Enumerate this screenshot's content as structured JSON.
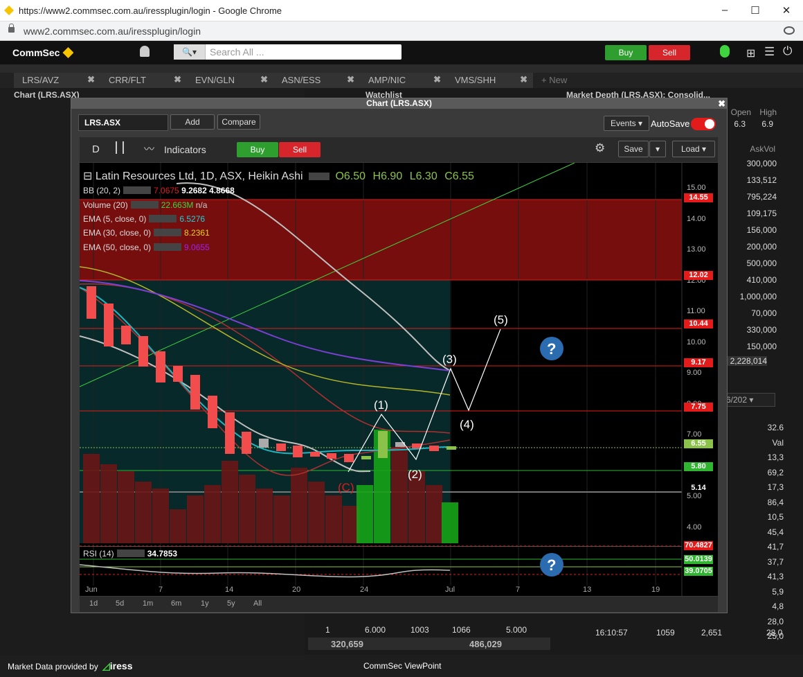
{
  "browser": {
    "title": "https://www2.commsec.com.au/iressplugin/login - Google Chrome",
    "url": "www2.commsec.com.au/iressplugin/login"
  },
  "app": {
    "logo": "CommSec",
    "search_placeholder": "Search All ...",
    "buy": "Buy",
    "sell": "Sell"
  },
  "tabs": [
    "LRS/AVZ",
    "CRR/FLT",
    "EVN/GLN",
    "ASN/ESS",
    "AMP/NIC",
    "VMS/SHH"
  ],
  "new_tab": "+ New",
  "panels": {
    "left": "Chart (LRS.ASX)",
    "watchlist": "Watchlist",
    "depth": "Market Depth (LRS.ASX): Consolid..."
  },
  "modal": {
    "title": "Chart (LRS.ASX)",
    "symbol": "LRS.ASX",
    "add": "Add",
    "compare": "Compare",
    "events": "Events",
    "autosave": "AutoSave",
    "interval": "D",
    "indicators": "Indicators",
    "buy": "Buy",
    "sell": "Sell",
    "save": "Save",
    "load": "Load"
  },
  "legend": {
    "name": "Latin Resources Ltd, 1D, ASX, Heikin Ashi",
    "o": "O6.50",
    "h": "H6.90",
    "l": "L6.30",
    "c": "C6.55"
  },
  "indicators": [
    {
      "label": "BB (20, 2)",
      "v1": "7.0675",
      "v2": "9.2682",
      "v3": "4.8668"
    },
    {
      "label": "Volume (20)",
      "v1": "22.663M",
      "v2": "n/a"
    },
    {
      "label": "EMA (5, close, 0)",
      "v1": "6.5276"
    },
    {
      "label": "EMA (30, close, 0)",
      "v1": "8.2361"
    },
    {
      "label": "EMA (50, close, 0)",
      "v1": "9.0655"
    }
  ],
  "price_axis": [
    "15.00",
    "14.00",
    "13.00",
    "12.00",
    "11.00",
    "10.00",
    "9.00",
    "8.00",
    "7.00",
    "6.00",
    "5.00",
    "4.00"
  ],
  "price_badges": [
    {
      "v": "14.55",
      "c": "#e31b1b"
    },
    {
      "v": "12.02",
      "c": "#e31b1b"
    },
    {
      "v": "10.44",
      "c": "#e31b1b"
    },
    {
      "v": "9.17",
      "c": "#e31b1b"
    },
    {
      "v": "7.75",
      "c": "#e31b1b"
    },
    {
      "v": "6.55",
      "c": "#8bc34a"
    },
    {
      "v": "5.80",
      "c": "#2fb52f"
    },
    {
      "v": "5.14",
      "c": "#000"
    }
  ],
  "waves": [
    "(1)",
    "(2)",
    "(3)",
    "(4)",
    "(5)",
    "(C)"
  ],
  "rsi": {
    "label": "RSI (14)",
    "value": "34.7853",
    "badges": [
      "70.4827",
      "50.0139",
      "39.0705"
    ]
  },
  "x_axis": [
    "Jun",
    "7",
    "14",
    "20",
    "24",
    "Jul",
    "7",
    "13",
    "19"
  ],
  "periods": [
    "1d",
    "5d",
    "1m",
    "6m",
    "1y",
    "5y",
    "All"
  ],
  "right": {
    "header": [
      "Open",
      "High"
    ],
    "hv": [
      "6.3",
      "6.9"
    ],
    "askvol": "AskVol",
    "vols": [
      "300,000",
      "133,512",
      "795,224",
      "109,175",
      "156,000",
      "200,000",
      "500,000",
      "410,000",
      "1,000,000",
      "70,000",
      "330,000",
      "150,000"
    ],
    "total": "2,228,014",
    "date": "6/202",
    "misc": [
      "32.6",
      "Val",
      "13,3",
      "69,2",
      "17,3",
      "86,4",
      "10,5",
      "45,4",
      "41,7",
      "37,7",
      "41,3",
      "5,9",
      "4,8",
      "28,0",
      "25,0"
    ]
  },
  "bottom": {
    "row1": [
      "1",
      "6.000",
      "1003",
      "1066",
      "5.000"
    ],
    "row2": [
      "320,659",
      "486,029"
    ],
    "trade": [
      "16:10:57",
      "1059",
      "2,651",
      "28,0"
    ]
  },
  "footer": {
    "provider": "Market Data provided by",
    "brand": "iress",
    "center": "CommSec ViewPoint"
  }
}
